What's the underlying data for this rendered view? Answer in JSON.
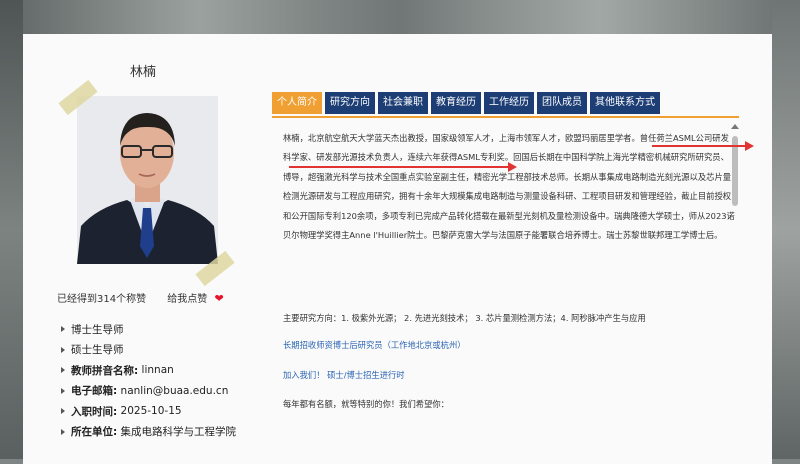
{
  "profile": {
    "name": "林楠",
    "likes_text": "已经得到314个称赞",
    "like_button": "给我点赞",
    "heart_icon": "heart-icon",
    "info": [
      {
        "label": "博士生导师",
        "value": ""
      },
      {
        "label": "硕士生导师",
        "value": ""
      },
      {
        "label": "教师拼音名称:",
        "value": "linnan"
      },
      {
        "label": "电子邮箱:",
        "value": "nanlin@buaa.edu.cn"
      },
      {
        "label": "入职时间:",
        "value": "2025-10-15"
      },
      {
        "label": "所在单位:",
        "value": "集成电路科学与工程学院"
      }
    ]
  },
  "tabs": [
    "个人简介",
    "研究方向",
    "社会兼职",
    "教育经历",
    "工作经历",
    "团队成员",
    "其他联系方式"
  ],
  "content": {
    "bio": "林楠，北京航空航天大学蓝天杰出教授，国家级领军人才，上海市领军人才，欧盟玛丽居里学者。曾任荷兰ASML公司研发科学家、研发部光源技术负责人，连续六年获得ASML专利奖。回国后长期在中国科学院上海光学精密机械研究所研究员、博导，超强激光科学与技术全国重点实验室副主任，精密光学工程部技术总师。长期从事集成电路制造光刻光源以及芯片量检测光源研发与工程应用研究，拥有十余年大规模集成电路制造与测量设备科研、工程项目研发和管理经验，截止目前授权和公开国际专利120余项，多项专利已完成产品转化搭载在最新型光刻机及量检测设备中。瑞典隆德大学硕士，师从2023诺贝尔物理学奖得主Anne l'Huillier院士。巴黎萨克雷大学与法国原子能署联合培养博士。瑞士苏黎世联邦理工学博士后。",
    "research": "主要研究方向：1. 极紫外光源；  2. 先进光刻技术；  3. 芯片量测检测方法；4. 阿秒脉冲产生与应用",
    "link1": "长期招收师资博士后研究员（工作地北京或杭州）",
    "link2": "加入我们！ 硕士/博士招生进行时",
    "closing": "每年都有名额，就等特别的你！我们希望你："
  },
  "colors": {
    "tab_blue": "#1d3e75",
    "tab_active": "#f0a033",
    "link": "#2a64b3",
    "annotation_arrow": "#e23333"
  }
}
